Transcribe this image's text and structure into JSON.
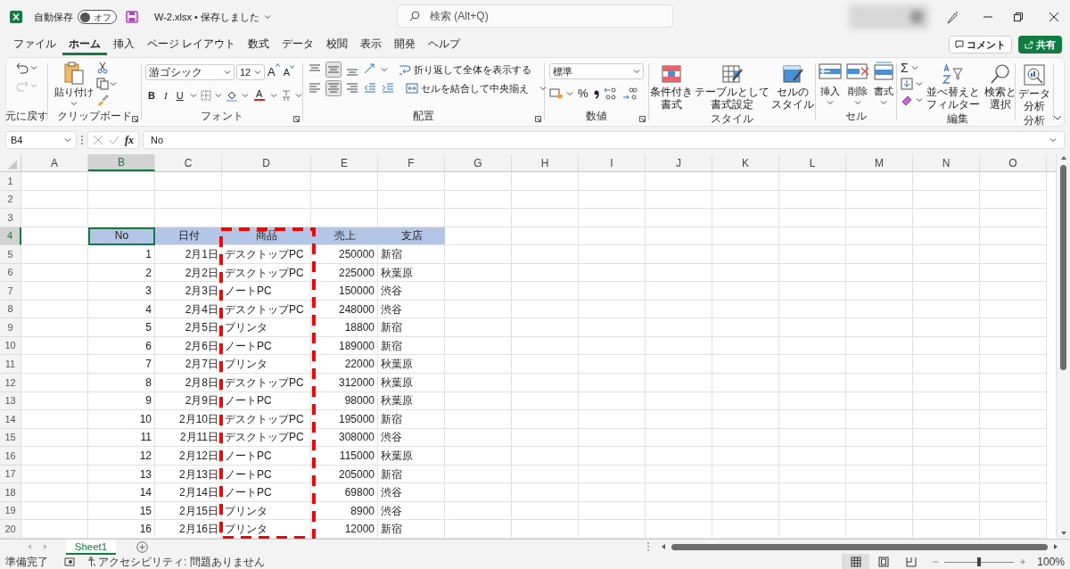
{
  "title_bar": {
    "autosave_label": "自動保存",
    "autosave_on": false,
    "autosave_state": "オフ",
    "document_title": "W-2.xlsx • 保存しました",
    "search": {
      "placeholder": "検索 (Alt+Q)"
    }
  },
  "menu_tabs": [
    {
      "label": "ファイル",
      "selected": false
    },
    {
      "label": "ホーム",
      "selected": true
    },
    {
      "label": "挿入",
      "selected": false
    },
    {
      "label": "ページ レイアウト",
      "selected": false
    },
    {
      "label": "数式",
      "selected": false
    },
    {
      "label": "データ",
      "selected": false
    },
    {
      "label": "校閲",
      "selected": false
    },
    {
      "label": "表示",
      "selected": false
    },
    {
      "label": "開発",
      "selected": false
    },
    {
      "label": "ヘルプ",
      "selected": false
    }
  ],
  "comment_button": "コメント",
  "share_button": "共有",
  "ribbon": {
    "undo": {
      "group": "元に戻す"
    },
    "clipboard": {
      "paste": "貼り付け",
      "group": "クリップボード"
    },
    "font": {
      "name": "游ゴシック",
      "size": "12",
      "grow": "A",
      "shrink": "A",
      "bold": "B",
      "italic": "I",
      "underline": "U",
      "font_color_letter": "A",
      "group": "フォント"
    },
    "alignment": {
      "wrap_text": "折り返して全体を表示する",
      "merge_center": "セルを結合して中央揃え",
      "group": "配置"
    },
    "number": {
      "format": "標準",
      "percent": "%",
      "group": "数値"
    },
    "styles": {
      "buttons": [
        {
          "lines": [
            "条件付き",
            "書式"
          ]
        },
        {
          "lines": [
            "テーブルとして",
            "書式設定"
          ]
        },
        {
          "lines": [
            "セルの",
            "スタイル"
          ]
        }
      ],
      "group": "スタイル"
    },
    "cells": {
      "buttons": [
        "挿入",
        "削除",
        "書式"
      ],
      "group": "セル"
    },
    "editing": {
      "autosum": "Σ",
      "buttons": [
        {
          "lines": [
            "並べ替えと",
            "フィルター"
          ]
        },
        {
          "lines": [
            "検索と",
            "選択"
          ]
        }
      ],
      "group": "編集"
    },
    "analysis": {
      "buttons": [
        {
          "lines": [
            "データ",
            "分析"
          ]
        }
      ],
      "group": "分析"
    }
  },
  "formula_bar": {
    "name_box": "B4",
    "function_label": "fx",
    "formula": "No"
  },
  "sheet": {
    "columns": [
      {
        "label": "A",
        "selected": false
      },
      {
        "label": "B",
        "selected": true
      },
      {
        "label": "C",
        "selected": false
      },
      {
        "label": "D",
        "selected": false
      },
      {
        "label": "E",
        "selected": false
      },
      {
        "label": "F",
        "selected": false
      },
      {
        "label": "G",
        "selected": false
      },
      {
        "label": "H",
        "selected": false
      },
      {
        "label": "I",
        "selected": false
      },
      {
        "label": "J",
        "selected": false
      },
      {
        "label": "K",
        "selected": false
      },
      {
        "label": "L",
        "selected": false
      },
      {
        "label": "M",
        "selected": false
      },
      {
        "label": "N",
        "selected": false
      },
      {
        "label": "O",
        "selected": false
      }
    ],
    "rows": [
      {
        "number": "1",
        "selected": false,
        "kind": "empty"
      },
      {
        "number": "2",
        "selected": false,
        "kind": "empty"
      },
      {
        "number": "3",
        "selected": false,
        "kind": "empty"
      },
      {
        "number": "4",
        "selected": true,
        "kind": "header",
        "cells": [
          "No",
          "日付",
          "商品",
          "売上",
          "支店"
        ]
      },
      {
        "number": "5",
        "selected": false,
        "kind": "data",
        "cells": [
          "1",
          "2月1日",
          "デスクトップPC",
          "250000",
          "新宿"
        ]
      },
      {
        "number": "6",
        "selected": false,
        "kind": "data",
        "cells": [
          "2",
          "2月2日",
          "デスクトップPC",
          "225000",
          "秋葉原"
        ]
      },
      {
        "number": "7",
        "selected": false,
        "kind": "data",
        "cells": [
          "3",
          "2月3日",
          "ノートPC",
          "150000",
          "渋谷"
        ]
      },
      {
        "number": "8",
        "selected": false,
        "kind": "data",
        "cells": [
          "4",
          "2月4日",
          "デスクトップPC",
          "248000",
          "渋谷"
        ]
      },
      {
        "number": "9",
        "selected": false,
        "kind": "data",
        "cells": [
          "5",
          "2月5日",
          "プリンタ",
          "18800",
          "新宿"
        ]
      },
      {
        "number": "10",
        "selected": false,
        "kind": "data",
        "cells": [
          "6",
          "2月6日",
          "ノートPC",
          "189000",
          "新宿"
        ]
      },
      {
        "number": "11",
        "selected": false,
        "kind": "data",
        "cells": [
          "7",
          "2月7日",
          "プリンタ",
          "22000",
          "秋葉原"
        ]
      },
      {
        "number": "12",
        "selected": false,
        "kind": "data",
        "cells": [
          "8",
          "2月8日",
          "デスクトップPC",
          "312000",
          "秋葉原"
        ]
      },
      {
        "number": "13",
        "selected": false,
        "kind": "data",
        "cells": [
          "9",
          "2月9日",
          "ノートPC",
          "98000",
          "秋葉原"
        ]
      },
      {
        "number": "14",
        "selected": false,
        "kind": "data",
        "cells": [
          "10",
          "2月10日",
          "デスクトップPC",
          "195000",
          "新宿"
        ]
      },
      {
        "number": "15",
        "selected": false,
        "kind": "data",
        "cells": [
          "11",
          "2月11日",
          "デスクトップPC",
          "308000",
          "渋谷"
        ]
      },
      {
        "number": "16",
        "selected": false,
        "kind": "data",
        "cells": [
          "12",
          "2月12日",
          "ノートPC",
          "115000",
          "秋葉原"
        ]
      },
      {
        "number": "17",
        "selected": false,
        "kind": "data",
        "cells": [
          "13",
          "2月13日",
          "ノートPC",
          "205000",
          "新宿"
        ]
      },
      {
        "number": "18",
        "selected": false,
        "kind": "data",
        "cells": [
          "14",
          "2月14日",
          "ノートPC",
          "69800",
          "渋谷"
        ]
      },
      {
        "number": "19",
        "selected": false,
        "kind": "data",
        "cells": [
          "15",
          "2月15日",
          "プリンタ",
          "8900",
          "渋谷"
        ]
      },
      {
        "number": "20",
        "selected": false,
        "kind": "data",
        "cells": [
          "16",
          "2月16日",
          "プリンタ",
          "12000",
          "新宿"
        ]
      }
    ]
  },
  "sheet_tabs": [
    {
      "label": "Sheet1",
      "selected": true
    }
  ],
  "status_bar": {
    "status": "準備完了",
    "accessibility": "アクセシビリティ: 問題ありません",
    "views": [
      {
        "kind": "normal",
        "selected": true
      },
      {
        "kind": "page_layout",
        "selected": false
      },
      {
        "kind": "page_break",
        "selected": false
      }
    ],
    "zoom": {
      "level": 0.5
    },
    "zoom_label": "100%"
  }
}
